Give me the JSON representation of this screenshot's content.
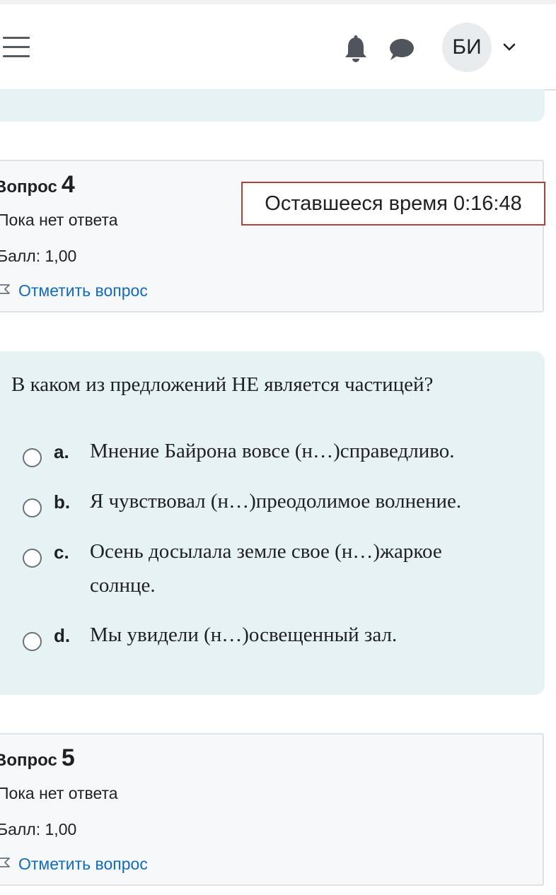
{
  "navbar": {
    "menu_icon": "hamburger-icon",
    "notifications_icon": "bell-icon",
    "messages_icon": "chat-bubble-icon",
    "user_initials": "БИ",
    "user_menu_icon": "chevron-down-icon"
  },
  "questions": [
    {
      "title_prefix": "Вопрос",
      "number": "4",
      "state": "Пока нет ответа",
      "grade": "Балл: 1,00",
      "flag_label": "Отметить вопрос",
      "flag_icon": "flag-icon"
    },
    {
      "title_prefix": "Вопрос",
      "number": "5",
      "state": "Пока нет ответа",
      "grade": "Балл: 1,00",
      "flag_label": "Отметить вопрос",
      "flag_icon": "flag-icon"
    }
  ],
  "timer": {
    "text": "Оставшееся время 0:16:48"
  },
  "question4": {
    "text": "В каком из предложений НЕ является частицей?",
    "answers": [
      {
        "letter": "a.",
        "text": "Мнение Байрона вовсе (н…)справедливо."
      },
      {
        "letter": "b.",
        "text": "Я чувствовал (н…)преодолимое волнение."
      },
      {
        "letter": "c.",
        "text": "Осень досылала земле свое (н…)жаркое солнце."
      },
      {
        "letter": "d.",
        "text": "Мы увидели (н…)освещенный зал."
      }
    ]
  },
  "colors": {
    "link": "#0f6cbf",
    "timer_border": "#b4403e",
    "formulation_bg": "#e7f2f5",
    "info_bg": "#f7f8f9"
  }
}
